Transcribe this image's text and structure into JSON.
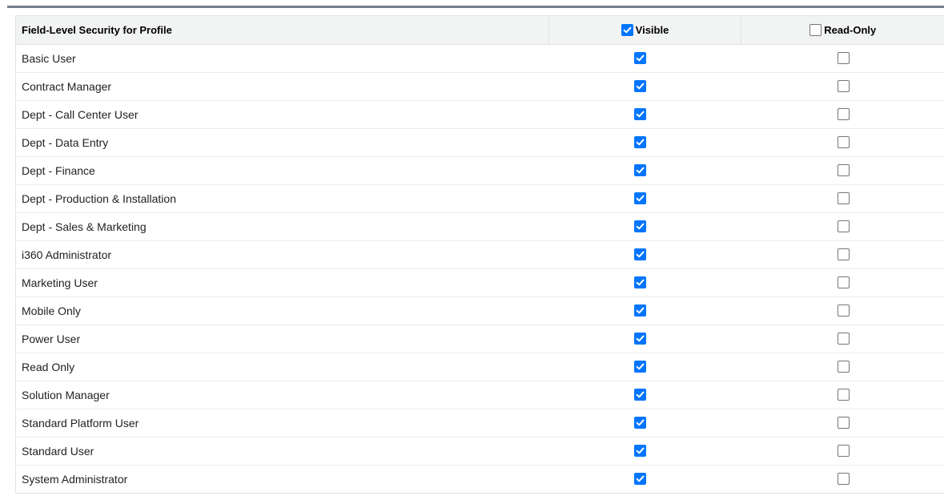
{
  "table": {
    "headers": {
      "profile": "Field-Level Security for Profile",
      "visible": "Visible",
      "read_only": "Read-Only",
      "visible_all_checked": true,
      "read_only_all_checked": false
    },
    "rows": [
      {
        "profile": "Basic User",
        "visible": true,
        "read_only": false
      },
      {
        "profile": "Contract Manager",
        "visible": true,
        "read_only": false
      },
      {
        "profile": "Dept - Call Center User",
        "visible": true,
        "read_only": false
      },
      {
        "profile": "Dept - Data Entry",
        "visible": true,
        "read_only": false
      },
      {
        "profile": "Dept - Finance",
        "visible": true,
        "read_only": false
      },
      {
        "profile": "Dept - Production & Installation",
        "visible": true,
        "read_only": false
      },
      {
        "profile": "Dept - Sales & Marketing",
        "visible": true,
        "read_only": false
      },
      {
        "profile": "i360 Administrator",
        "visible": true,
        "read_only": false
      },
      {
        "profile": "Marketing User",
        "visible": true,
        "read_only": false
      },
      {
        "profile": "Mobile Only",
        "visible": true,
        "read_only": false
      },
      {
        "profile": "Power User",
        "visible": true,
        "read_only": false
      },
      {
        "profile": "Read Only",
        "visible": true,
        "read_only": false
      },
      {
        "profile": "Solution Manager",
        "visible": true,
        "read_only": false
      },
      {
        "profile": "Standard Platform User",
        "visible": true,
        "read_only": false
      },
      {
        "profile": "Standard User",
        "visible": true,
        "read_only": false
      },
      {
        "profile": "System Administrator",
        "visible": true,
        "read_only": false
      }
    ]
  },
  "colors": {
    "checkbox_checked": "#0075ff",
    "header_background": "#f2f3f3",
    "top_rule": "#747e8b"
  },
  "icons": {
    "checked": "checkbox-checked-icon",
    "unchecked": "checkbox-unchecked-icon"
  }
}
